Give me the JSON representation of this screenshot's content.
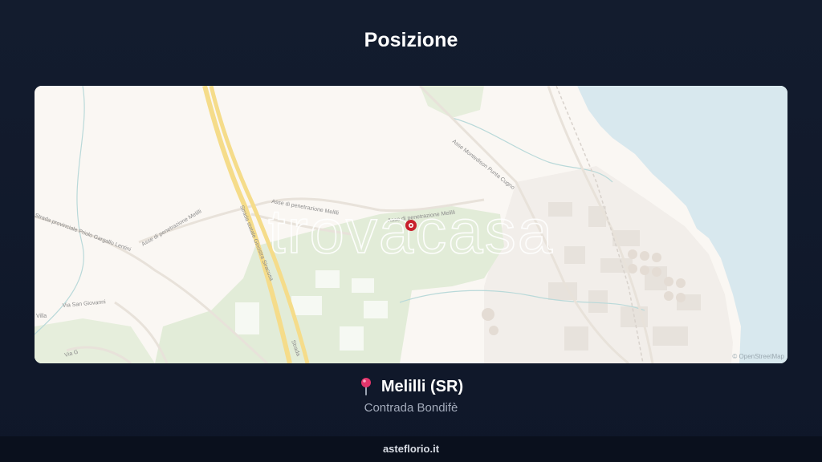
{
  "header": {
    "title": "Posizione"
  },
  "map": {
    "watermark": "trovacasa",
    "attribution": "© OpenStreetMap",
    "road_labels": [
      "Strada statale Ginostra Siracusa",
      "Asse di penetrazione Melilli",
      "Asse di penetrazione Melilli",
      "Asse di penetrazione Melilli",
      "Asse Montedison Punta Cugno",
      "Strada provinciale Priolo Gargallo Lentini",
      "Via San Giovanni",
      "Strada",
      "Villa",
      "Via G"
    ],
    "colors": {
      "land": "#faf7f3",
      "sea": "#d8e8ee",
      "park": "#e2ecd8",
      "highway": "#f5dc8a",
      "marker": "#c8202c"
    }
  },
  "location": {
    "pin_icon": "pin-icon",
    "name": "Melilli (SR)",
    "address": "Contrada Bondifè"
  },
  "footer": {
    "site": "asteflorio.it"
  }
}
